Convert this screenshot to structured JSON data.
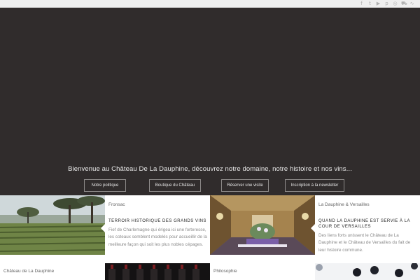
{
  "social_icons": [
    "facebook-icon",
    "twitter-icon",
    "youtube-icon",
    "pinterest-icon",
    "instagram-icon",
    "cart-icon",
    "rss-icon"
  ],
  "social_glyphs": [
    "f",
    "t",
    "▶",
    "p",
    "◎",
    "⛟",
    "∿"
  ],
  "hero": {
    "title": "Bienvenue au Château De La Dauphine, découvrez notre domaine, notre histoire et nos vins...",
    "buttons": [
      "Notre politique",
      "Boutique du Château",
      "Réserver une visite",
      "Inscription à la newsletter"
    ]
  },
  "tiles": [
    {
      "category": "Fronsac",
      "title": "TERROIR HISTORIQUE DES GRANDS VINS",
      "description": "Fief de Charlemagne qui érigea ici une forteresse, les coteaux semblent modelés pour accueillir de la meilleure façon qui soit les plus nobles cépages."
    },
    {
      "category": "La Dauphine & Versailles",
      "title": "QUAND LA DAUPHINE EST SERVIE À LA COUR DE VERSAILLES",
      "description": "Des liens forts unissent le Château de La Dauphine et le Château de Versailles du fait de leur histoire commune."
    },
    {
      "category": "Château de La Dauphine"
    },
    {
      "category": "Philosophie"
    }
  ],
  "colors": {
    "hero_bg": "#302c2c",
    "button_border": "#8d8a89",
    "topbar": "#efefef"
  }
}
